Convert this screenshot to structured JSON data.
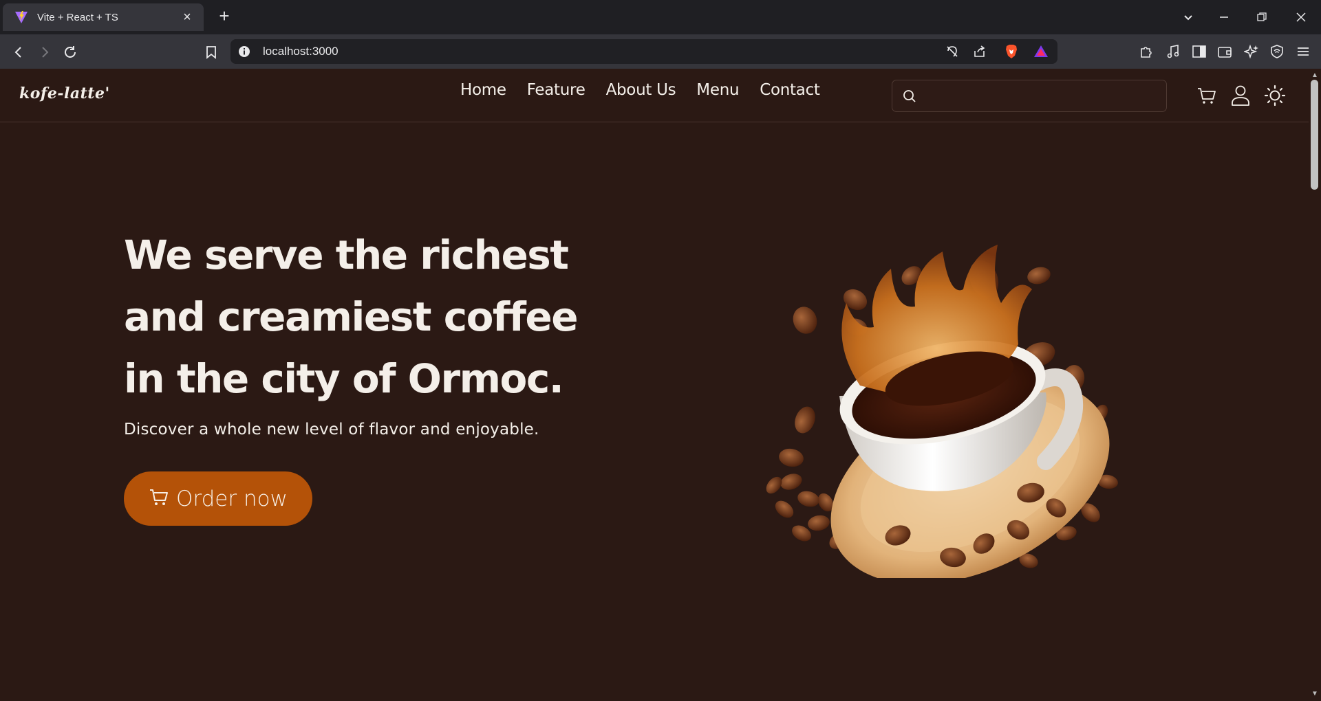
{
  "browser": {
    "tab_title": "Vite + React + TS",
    "url": "localhost:3000"
  },
  "site": {
    "logo": "kofe-latte'",
    "nav": [
      "Home",
      "Feature",
      "About Us",
      "Menu",
      "Contact"
    ],
    "search_placeholder": ""
  },
  "hero": {
    "title_lines": [
      "We serve the richest",
      "and creamiest coffee",
      "in the city of Ormoc."
    ],
    "subtitle": "Discover a whole new level of flavor and enjoyable.",
    "cta_label": "Order now"
  },
  "colors": {
    "page_bg": "#2b1914",
    "accent": "#b45208",
    "text": "#f4efe9"
  },
  "icons": [
    "back-icon",
    "forward-icon",
    "reload-icon",
    "bookmark-icon",
    "site-info-icon",
    "cart-icon",
    "user-icon",
    "sun-icon",
    "search-icon"
  ]
}
